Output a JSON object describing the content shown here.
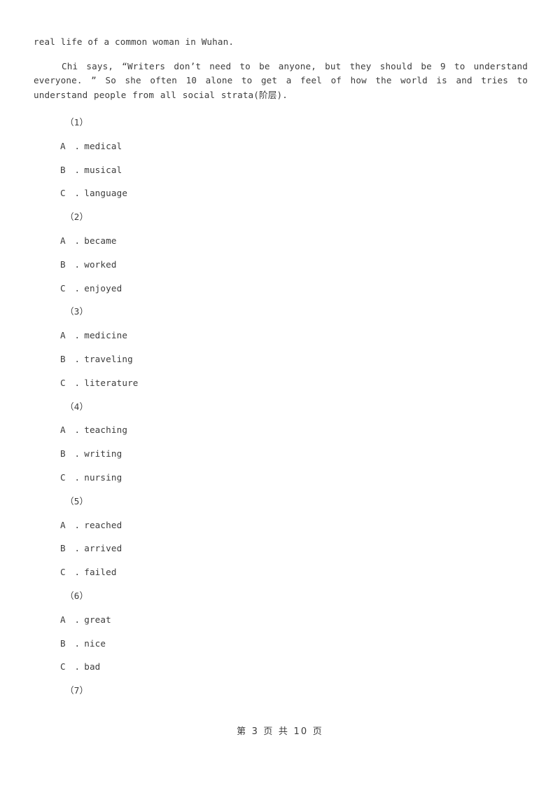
{
  "document": {
    "passage": {
      "continuation_line": "real life of a common woman in Wuhan.",
      "paragraph": "Chi says, “Writers don’t need to be anyone, but they should be 9 to understand everyone. ” So she often 10 alone to get a feel of how the world is and tries to understand people from all social strata(阶层)."
    },
    "questions": [
      {
        "number": "（1）",
        "options": [
          {
            "letter": "A　.",
            "text": "medical"
          },
          {
            "letter": "B　.",
            "text": "musical"
          },
          {
            "letter": "C　.",
            "text": "language"
          }
        ]
      },
      {
        "number": "（2）",
        "options": [
          {
            "letter": "A　.",
            "text": "became"
          },
          {
            "letter": "B　.",
            "text": "worked"
          },
          {
            "letter": "C　.",
            "text": "enjoyed"
          }
        ]
      },
      {
        "number": "（3）",
        "options": [
          {
            "letter": "A　.",
            "text": "medicine"
          },
          {
            "letter": "B　.",
            "text": "traveling"
          },
          {
            "letter": "C　.",
            "text": "literature"
          }
        ]
      },
      {
        "number": "（4）",
        "options": [
          {
            "letter": "A　.",
            "text": "teaching"
          },
          {
            "letter": "B　.",
            "text": "writing"
          },
          {
            "letter": "C　.",
            "text": "nursing"
          }
        ]
      },
      {
        "number": "（5）",
        "options": [
          {
            "letter": "A　.",
            "text": "reached"
          },
          {
            "letter": "B　.",
            "text": "arrived"
          },
          {
            "letter": "C　.",
            "text": "failed"
          }
        ]
      },
      {
        "number": "（6）",
        "options": [
          {
            "letter": "A　.",
            "text": "great"
          },
          {
            "letter": "B　.",
            "text": "nice"
          },
          {
            "letter": "C　.",
            "text": "bad"
          }
        ]
      },
      {
        "number": "（7）",
        "options": []
      }
    ]
  },
  "footer": {
    "page_label": "第 3 页 共 10 页",
    "current_page": "3",
    "total_pages": "10"
  },
  "colors": {
    "page_background": "#ffffff",
    "text": "#3c3c3c"
  }
}
